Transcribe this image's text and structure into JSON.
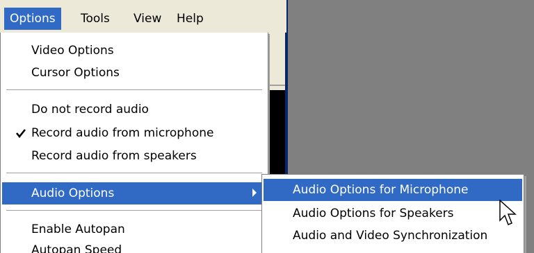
{
  "menubar": {
    "items": [
      {
        "label": "Options"
      },
      {
        "label": "Tools"
      },
      {
        "label": "View"
      },
      {
        "label": "Help"
      }
    ]
  },
  "options_menu": {
    "items": [
      {
        "label": "Video Options"
      },
      {
        "label": "Cursor Options"
      },
      {
        "label": "Do not record audio"
      },
      {
        "label": "Record audio from microphone",
        "checked": true
      },
      {
        "label": "Record audio from speakers"
      },
      {
        "label": "Audio Options",
        "has_submenu": true,
        "highlighted": true
      },
      {
        "label": "Enable Autopan"
      },
      {
        "label": "Autopan Speed"
      }
    ]
  },
  "audio_submenu": {
    "items": [
      {
        "label": "Audio Options for Microphone",
        "highlighted": true
      },
      {
        "label": "Audio Options for Speakers"
      },
      {
        "label": "Audio and  Video Synchronization"
      }
    ]
  },
  "icons": {
    "check": "checkmark-icon",
    "submenu_arrow": "chevron-right-icon",
    "cursor": "mouse-pointer-icon"
  },
  "colors": {
    "highlight": "#316ac5",
    "menu_bg": "#ffffff",
    "chrome_bg": "#ece9d8",
    "canvas_bg": "#808080",
    "border_accent": "#0a246a"
  }
}
